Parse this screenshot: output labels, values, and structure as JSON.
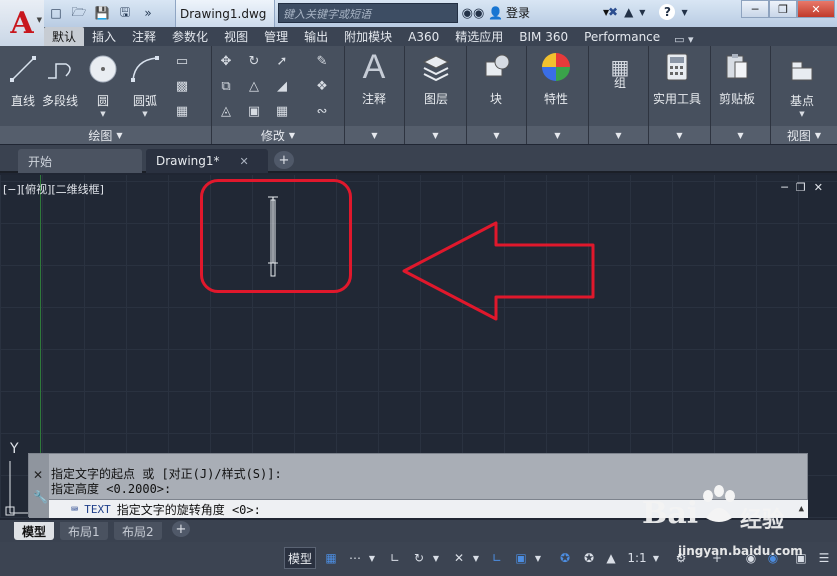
{
  "titlebar": {
    "doc_title": "Drawing1.dwg",
    "search_placeholder": "键入关键字或短语",
    "login_label": "登录"
  },
  "ribbon_tabs": [
    {
      "label": "默认",
      "active": true
    },
    {
      "label": "插入"
    },
    {
      "label": "注释"
    },
    {
      "label": "参数化"
    },
    {
      "label": "视图"
    },
    {
      "label": "管理"
    },
    {
      "label": "输出"
    },
    {
      "label": "附加模块"
    },
    {
      "label": "A360"
    },
    {
      "label": "精选应用"
    },
    {
      "label": "BIM 360"
    },
    {
      "label": "Performance"
    }
  ],
  "ribbon": {
    "draw": {
      "line": "直线",
      "polyline": "多段线",
      "circle": "圆",
      "arc": "圆弧",
      "footer": "绘图"
    },
    "modify": {
      "footer": "修改"
    },
    "annotation": "注释",
    "layers": "图层",
    "block": "块",
    "properties": "特性",
    "group": "组",
    "utilities": "实用工具",
    "clipboard": "剪贴板",
    "base": "基点",
    "view_footer": "视图"
  },
  "doc_tabs": {
    "start": "开始",
    "drawing": "Drawing1*"
  },
  "viewport": {
    "label": "[−][俯视][二维线框]",
    "axis_y": "Y"
  },
  "command": {
    "history_1": "指定文字的起点 或 [对正(J)/样式(S)]:",
    "history_2": "指定高度 <0.2000>:",
    "prompt_cmd": "TEXT",
    "prompt_text": "指定文字的旋转角度 <0>:"
  },
  "layout_tabs": {
    "model": "模型",
    "layout1": "布局1",
    "layout2": "布局2"
  },
  "statusbar": {
    "model": "模型",
    "scale": "1:1"
  },
  "watermark": {
    "brand": "Bai",
    "brand_zh": "经验",
    "url": "jingyan.baidu.com"
  },
  "colors": {
    "highlight": "#e0182c",
    "canvas": "#212835",
    "ribbon": "#47505e"
  }
}
